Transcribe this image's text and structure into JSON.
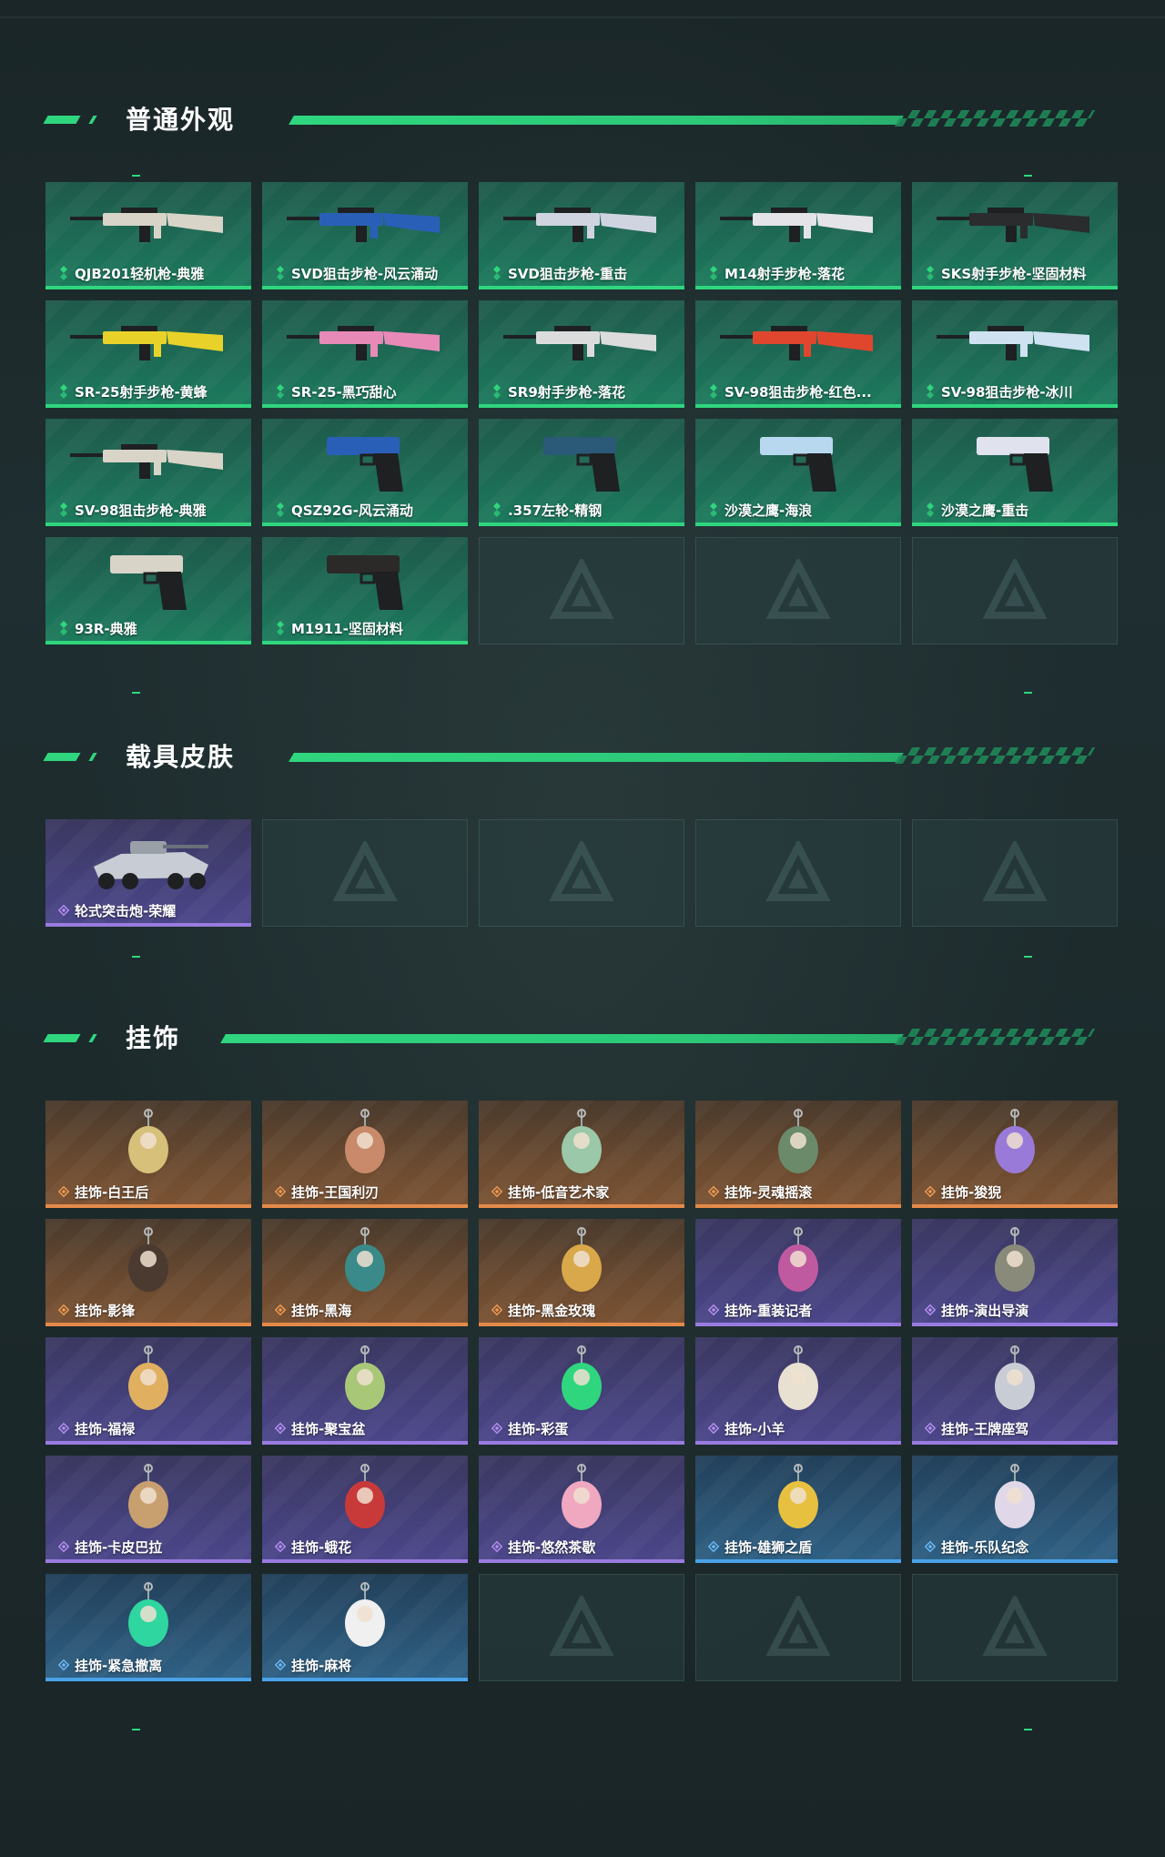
{
  "sections": {
    "weapon_skins": {
      "title": "普通外观",
      "items": [
        {
          "label": "QJB201轻机枪-典雅",
          "rarity": "green",
          "icon": "lmg-icon",
          "color": "#d8d4c8"
        },
        {
          "label": "SVD狙击步枪-风云涌动",
          "rarity": "green",
          "icon": "sniper-rifle-icon",
          "color": "#2a5fb8"
        },
        {
          "label": "SVD狙击步枪-重击",
          "rarity": "green",
          "icon": "sniper-rifle-icon",
          "color": "#d0d4e0"
        },
        {
          "label": "M14射手步枪-落花",
          "rarity": "green",
          "icon": "rifle-icon",
          "color": "#e4e4e8"
        },
        {
          "label": "SKS射手步枪-坚固材料",
          "rarity": "green",
          "icon": "rifle-icon",
          "color": "#2a2c2e"
        },
        {
          "label": "SR-25射手步枪-黄蜂",
          "rarity": "green",
          "icon": "rifle-icon",
          "color": "#e8d22a"
        },
        {
          "label": "SR-25-黑巧甜心",
          "rarity": "green",
          "icon": "rifle-icon",
          "color": "#e88ab8"
        },
        {
          "label": "SR9射手步枪-落花",
          "rarity": "green",
          "icon": "rifle-icon",
          "color": "#dcdcdc"
        },
        {
          "label": "SV-98狙击步枪-红色...",
          "rarity": "green",
          "icon": "sniper-rifle-icon",
          "color": "#e0462e"
        },
        {
          "label": "SV-98狙击步枪-冰川",
          "rarity": "green",
          "icon": "sniper-rifle-icon",
          "color": "#cfe2f2"
        },
        {
          "label": "SV-98狙击步枪-典雅",
          "rarity": "green",
          "icon": "sniper-rifle-icon",
          "color": "#d8d4c8"
        },
        {
          "label": "QSZ92G-风云涌动",
          "rarity": "green",
          "icon": "pistol-icon",
          "color": "#2a5fb8"
        },
        {
          "label": ".357左轮-精钢",
          "rarity": "green",
          "icon": "revolver-icon",
          "color": "#2a5a78"
        },
        {
          "label": "沙漠之鹰-海浪",
          "rarity": "green",
          "icon": "pistol-icon",
          "color": "#b8d8f0"
        },
        {
          "label": "沙漠之鹰-重击",
          "rarity": "green",
          "icon": "pistol-icon",
          "color": "#e0e2ee"
        },
        {
          "label": "93R-典雅",
          "rarity": "green",
          "icon": "pistol-icon",
          "color": "#d8d4c8"
        },
        {
          "label": "M1911-坚固材料",
          "rarity": "green",
          "icon": "pistol-icon",
          "color": "#2c2a28"
        }
      ],
      "empty_slots": 3
    },
    "vehicle_skins": {
      "title": "载具皮肤",
      "items": [
        {
          "label": "轮式突击炮-荣耀",
          "rarity": "purple",
          "icon": "armored-vehicle-icon",
          "color": "#c8ccd4"
        }
      ],
      "empty_slots": 4
    },
    "charms": {
      "title": "挂饰",
      "items": [
        {
          "label": "挂饰-白王后",
          "rarity": "orange",
          "icon": "queen-charm-icon",
          "color": "#d6c07a"
        },
        {
          "label": "挂饰-王国利刃",
          "rarity": "orange",
          "icon": "knight-charm-icon",
          "color": "#c88a6a"
        },
        {
          "label": "挂饰-低音艺术家",
          "rarity": "orange",
          "icon": "bassist-charm-icon",
          "color": "#9ac8a8"
        },
        {
          "label": "挂饰-灵魂摇滚",
          "rarity": "orange",
          "icon": "rocker-charm-icon",
          "color": "#6a8a6a"
        },
        {
          "label": "挂饰-狻猊",
          "rarity": "orange",
          "icon": "lion-charm-icon",
          "color": "#9a7ad8"
        },
        {
          "label": "挂饰-影锋",
          "rarity": "orange",
          "icon": "dagger-charm-icon",
          "color": "#4a3a30"
        },
        {
          "label": "挂饰-黑海",
          "rarity": "orange",
          "icon": "anchor-charm-icon",
          "color": "#3a8a8a"
        },
        {
          "label": "挂饰-黑金玫瑰",
          "rarity": "orange",
          "icon": "rose-charm-icon",
          "color": "#d8a84a"
        },
        {
          "label": "挂饰-重装记者",
          "rarity": "purple",
          "icon": "reporter-charm-icon",
          "color": "#c05aa0"
        },
        {
          "label": "挂饰-演出导演",
          "rarity": "purple",
          "icon": "director-charm-icon",
          "color": "#8a8a7a"
        },
        {
          "label": "挂饰-福禄",
          "rarity": "purple",
          "icon": "gourd-charm-icon",
          "color": "#e0b060"
        },
        {
          "label": "挂饰-聚宝盆",
          "rarity": "purple",
          "icon": "treasure-bowl-charm-icon",
          "color": "#a8c878"
        },
        {
          "label": "挂饰-彩蛋",
          "rarity": "purple",
          "icon": "egg-charm-icon",
          "color": "#2fd67e"
        },
        {
          "label": "挂饰-小羊",
          "rarity": "purple",
          "icon": "lamb-charm-icon",
          "color": "#e8e0d0"
        },
        {
          "label": "挂饰-王牌座驾",
          "rarity": "purple",
          "icon": "jet-charm-icon",
          "color": "#c8ccd4"
        },
        {
          "label": "挂饰-卡皮巴拉",
          "rarity": "purple",
          "icon": "capybara-charm-icon",
          "color": "#c8a070"
        },
        {
          "label": "挂饰-蛾花",
          "rarity": "purple",
          "icon": "flower-charm-icon",
          "color": "#c83a3a"
        },
        {
          "label": "挂饰-悠然茶歇",
          "rarity": "purple",
          "icon": "cupcake-charm-icon",
          "color": "#f0a8c0"
        },
        {
          "label": "挂饰-雄狮之盾",
          "rarity": "blue",
          "icon": "shield-charm-icon",
          "color": "#e8c040"
        },
        {
          "label": "挂饰-乐队纪念",
          "rarity": "blue",
          "icon": "ornament-charm-icon",
          "color": "#e0d8e8"
        },
        {
          "label": "挂饰-紧急撤离",
          "rarity": "blue",
          "icon": "sign-charm-icon",
          "color": "#2fd6a0"
        },
        {
          "label": "挂饰-麻将",
          "rarity": "blue",
          "icon": "mahjong-charm-icon",
          "color": "#f0f0f0"
        }
      ],
      "empty_slots": 3
    }
  },
  "colors": {
    "accent": "#2fd67e",
    "green_rarity": "#2fd67e",
    "purple_rarity": "#9a7be0",
    "orange_rarity": "#e48a48",
    "blue_rarity": "#4aa2e8"
  }
}
